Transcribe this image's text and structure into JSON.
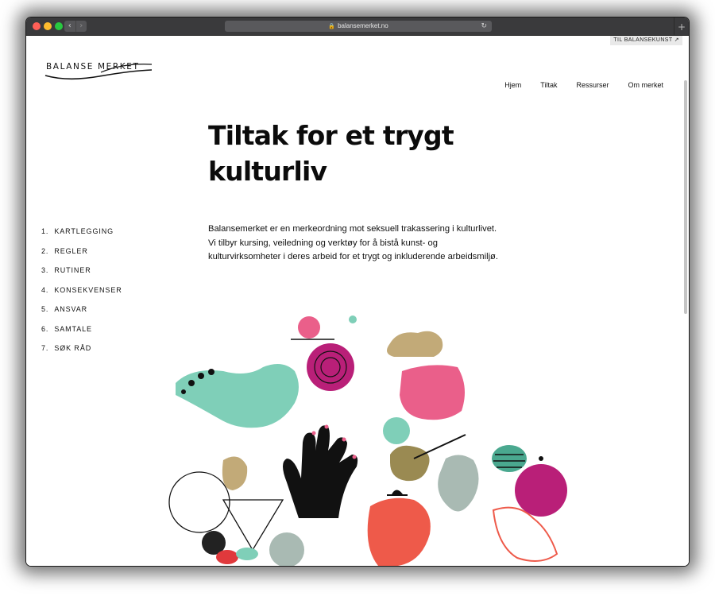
{
  "browser": {
    "url": "balansemerket.no",
    "back_icon": "chevron-left-icon",
    "forward_icon": "chevron-right-icon",
    "reload_icon": "reload-icon",
    "new_tab_icon": "plus-icon"
  },
  "header": {
    "logo_text": "BALANSE MERKET",
    "corner_link": "TIL BALANSEKUNST ↗",
    "nav": [
      "Hjem",
      "Tiltak",
      "Ressurser",
      "Om merket"
    ]
  },
  "main": {
    "title": "Tiltak for et trygt kulturliv",
    "intro": "Balansemerket er en merkeordning mot seksuell trakassering i kulturlivet. Vi tilbyr kursing, veiledning og verktøy for å bistå kunst- og kulturvirksomheter i deres arbeid for et trygt og inkluderende arbeidsmiljø."
  },
  "toc": [
    {
      "num": "1.",
      "label": "KARTLEGGING"
    },
    {
      "num": "2.",
      "label": "REGLER"
    },
    {
      "num": "3.",
      "label": "RUTINER"
    },
    {
      "num": "4.",
      "label": "KONSEKVENSER"
    },
    {
      "num": "5.",
      "label": "ANSVAR"
    },
    {
      "num": "6.",
      "label": "SAMTALE"
    },
    {
      "num": "7.",
      "label": "SØK RÅD"
    }
  ],
  "colors": {
    "mint": "#7fcfb8",
    "pink": "#ea5f8a",
    "magenta": "#b91f78",
    "coral": "#ee5a4a",
    "olive": "#9a8a52",
    "grey": "#a9bab3",
    "black": "#111111"
  }
}
